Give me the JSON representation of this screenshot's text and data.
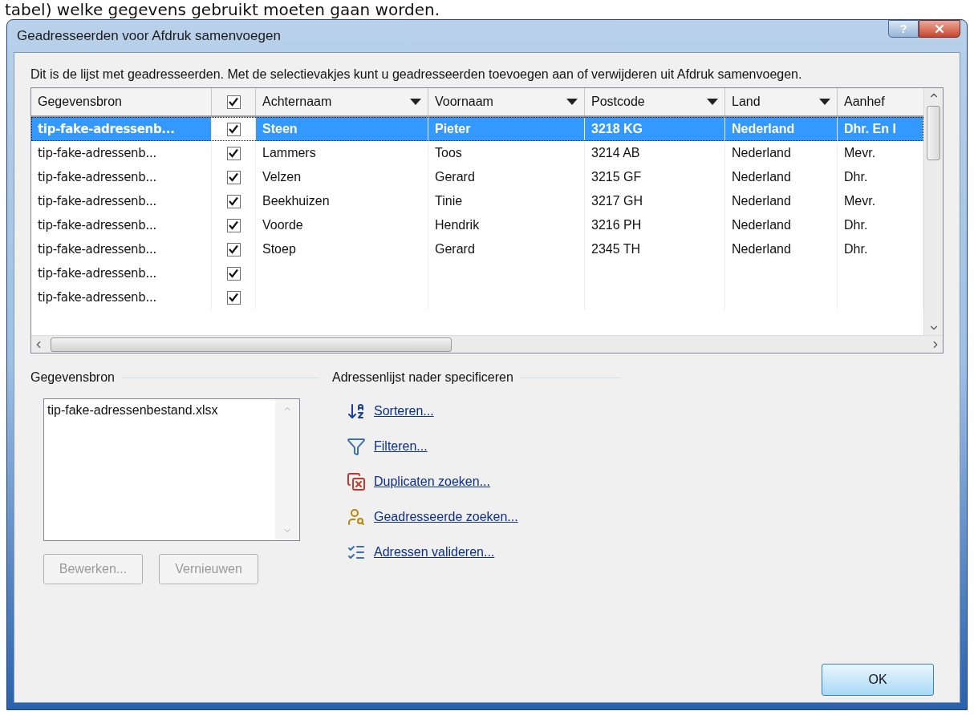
{
  "page_caption": "tabel) welke gegevens gebruikt moeten gaan worden.",
  "window": {
    "title": "Geadresseerden voor Afdruk samenvoegen",
    "help_button": "?"
  },
  "description": "Dit is de lijst met geadresseerden. Met de selectievakjes kunt u geadresseerden toevoegen aan of verwijderen uit Afdruk samenvoegen.",
  "table": {
    "all_checked": true,
    "columns": [
      {
        "label": "Gegevensbron",
        "filter_arrow": false
      },
      {
        "label": "Achternaam",
        "filter_arrow": true
      },
      {
        "label": "Voornaam",
        "filter_arrow": true
      },
      {
        "label": "Postcode",
        "filter_arrow": true
      },
      {
        "label": "Land",
        "filter_arrow": true
      },
      {
        "label": "Aanhef",
        "filter_arrow": false
      }
    ],
    "rows": [
      {
        "source": "tip-fake-adressenb...",
        "checked": true,
        "selected": true,
        "cells": [
          "Steen",
          "Pieter",
          "3218 KG",
          "Nederland",
          "Dhr. En I"
        ]
      },
      {
        "source": "tip-fake-adressenb...",
        "checked": true,
        "selected": false,
        "cells": [
          "Lammers",
          "Toos",
          "3214 AB",
          "Nederland",
          "Mevr."
        ]
      },
      {
        "source": "tip-fake-adressenb...",
        "checked": true,
        "selected": false,
        "cells": [
          "Velzen",
          "Gerard",
          "3215 GF",
          "Nederland",
          "Dhr."
        ]
      },
      {
        "source": "tip-fake-adressenb...",
        "checked": true,
        "selected": false,
        "cells": [
          "Beekhuizen",
          "Tinie",
          "3217 GH",
          "Nederland",
          "Mevr."
        ]
      },
      {
        "source": "tip-fake-adressenb...",
        "checked": true,
        "selected": false,
        "cells": [
          "Voorde",
          "Hendrik",
          "3216 PH",
          "Nederland",
          "Dhr."
        ]
      },
      {
        "source": "tip-fake-adressenb...",
        "checked": true,
        "selected": false,
        "cells": [
          "Stoep",
          "Gerard",
          "2345 TH",
          "Nederland",
          "Dhr."
        ]
      },
      {
        "source": "tip-fake-adressenb...",
        "checked": true,
        "selected": false
      },
      {
        "source": "tip-fake-adressenb...",
        "checked": true,
        "selected": false
      }
    ]
  },
  "data_source": {
    "heading": "Gegevensbron",
    "items": [
      "tip-fake-adressenbestand.xlsx"
    ],
    "buttons": [
      {
        "label": "Bewerken...",
        "disabled": true
      },
      {
        "label": "Vernieuwen",
        "disabled": true
      }
    ]
  },
  "refine": {
    "heading": "Adressenlijst nader specificeren",
    "links": [
      {
        "kind": "sort",
        "label": "Sorteren..."
      },
      {
        "kind": "filter",
        "label": "Filteren..."
      },
      {
        "kind": "duplicates",
        "label": "Duplicaten zoeken..."
      },
      {
        "kind": "find",
        "label": "Geadresseerde zoeken..."
      },
      {
        "kind": "validate",
        "label": "Adressen valideren..."
      }
    ]
  },
  "ok_button": {
    "label": "OK",
    "disabled": false
  }
}
